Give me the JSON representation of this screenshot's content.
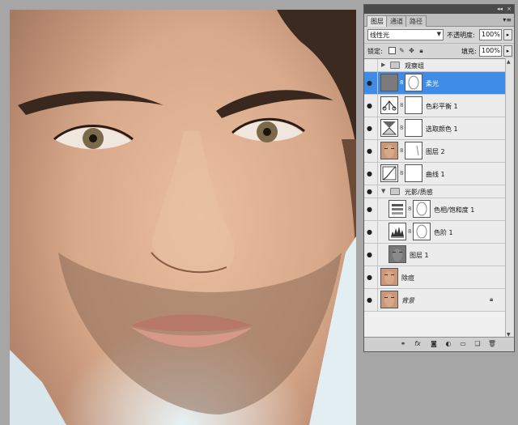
{
  "panel": {
    "tabs": [
      {
        "label": "图层",
        "active": true
      },
      {
        "label": "通道",
        "active": false
      },
      {
        "label": "路径",
        "active": false
      }
    ],
    "collapse_glyph": "◂◂",
    "close_glyph": "×",
    "menu_glyph": "▾≡",
    "blend_mode": "线性光",
    "opacity_label": "不透明度:",
    "opacity_value": "100%",
    "lock_label": "锁定:",
    "fill_label": "填充:",
    "fill_value": "100%"
  },
  "layers": [
    {
      "name": "观察组",
      "type": "group",
      "visible": false,
      "expanded": false
    },
    {
      "name": "柔光",
      "type": "fill",
      "visible": true,
      "selected": true
    },
    {
      "name": "色彩平衡 1",
      "type": "adjustment",
      "icon": "color-balance-icon",
      "visible": true
    },
    {
      "name": "选取颜色 1",
      "type": "adjustment",
      "icon": "selective-color-icon",
      "visible": true
    },
    {
      "name": "图层 2",
      "type": "pixel",
      "visible": true
    },
    {
      "name": "曲线 1",
      "type": "adjustment",
      "icon": "curves-icon",
      "visible": true
    },
    {
      "name": "光影/质感",
      "type": "group",
      "visible": true,
      "expanded": true
    },
    {
      "name": "色相/饱和度 1",
      "type": "adjustment",
      "icon": "hue-saturation-icon",
      "visible": true
    },
    {
      "name": "色阶 1",
      "type": "adjustment",
      "icon": "levels-icon",
      "visible": true
    },
    {
      "name": "图层 1",
      "type": "pixel",
      "visible": true
    },
    {
      "name": "除痘",
      "type": "pixel",
      "visible": true
    },
    {
      "name": "背景",
      "type": "background",
      "visible": true,
      "locked": true
    }
  ],
  "footer_icons": [
    "link-layers-icon",
    "fx-icon",
    "add-mask-icon",
    "new-adjustment-icon",
    "new-group-icon",
    "new-layer-icon",
    "delete-icon"
  ],
  "colors": {
    "selection": "#3f8ce6",
    "panel_bg": "#d6d6d6",
    "workspace": "#a6a6a6"
  }
}
